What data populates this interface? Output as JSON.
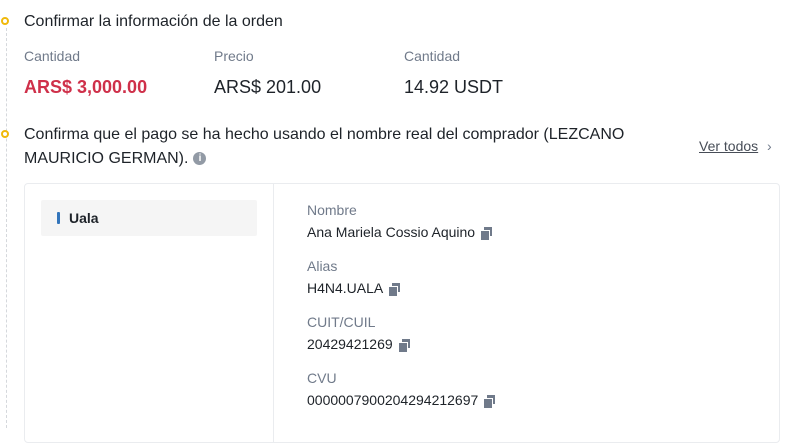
{
  "step1": {
    "title": "Confirmar la información de la orden",
    "summary": [
      {
        "label": "Cantidad",
        "value": "ARS$ 3,000.00"
      },
      {
        "label": "Precio",
        "value": "ARS$ 201.00"
      },
      {
        "label": "Cantidad",
        "value": "14.92 USDT"
      }
    ]
  },
  "step2": {
    "text": "Confirma que el pago se ha hecho usando el nombre real del comprador (LEZCANO MAURICIO GERMAN).",
    "info_icon": "info-icon",
    "ver_todos": "Ver todos"
  },
  "payment": {
    "method": "Uala",
    "fields": [
      {
        "label": "Nombre",
        "value": "Ana Mariela Cossio Aquino"
      },
      {
        "label": "Alias",
        "value": "H4N4.UALA"
      },
      {
        "label": "CUIT/CUIL",
        "value": "20429421269"
      },
      {
        "label": "CVU",
        "value": "0000007900204294212697"
      }
    ]
  },
  "colors": {
    "accent": "#f0b90b",
    "amount_red": "#cf304a",
    "method_bar": "#3375bb"
  }
}
